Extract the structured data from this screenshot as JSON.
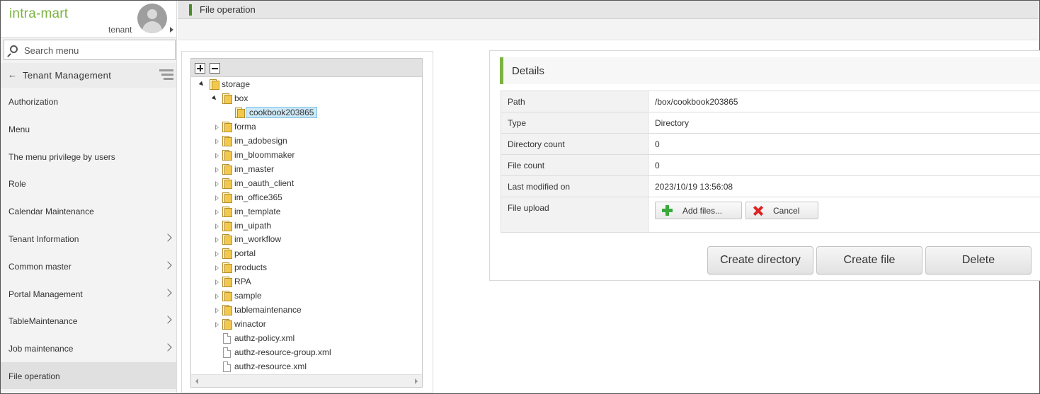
{
  "app": {
    "logo": "intra-mart",
    "tenant": "tenant"
  },
  "search": {
    "placeholder": "Search menu"
  },
  "sidebar": {
    "section_title": "Tenant Management",
    "items": [
      {
        "label": "Authorization",
        "has_submenu": false
      },
      {
        "label": "Menu",
        "has_submenu": false
      },
      {
        "label": "The menu privilege by users",
        "has_submenu": false
      },
      {
        "label": "Role",
        "has_submenu": false
      },
      {
        "label": "Calendar Maintenance",
        "has_submenu": false
      },
      {
        "label": "Tenant Information",
        "has_submenu": true
      },
      {
        "label": "Common master",
        "has_submenu": true
      },
      {
        "label": "Portal Management",
        "has_submenu": true
      },
      {
        "label": "TableMaintenance",
        "has_submenu": true
      },
      {
        "label": "Job maintenance",
        "has_submenu": true
      },
      {
        "label": "File operation",
        "has_submenu": false,
        "active": true
      }
    ]
  },
  "page": {
    "title": "File operation"
  },
  "tree": {
    "nodes": [
      {
        "label": "storage",
        "type": "folder",
        "level": 0,
        "state": "open"
      },
      {
        "label": "box",
        "type": "folder",
        "level": 1,
        "state": "open"
      },
      {
        "label": "cookbook203865",
        "type": "folder",
        "level": 2,
        "state": "leaf",
        "selected": true
      },
      {
        "label": "forma",
        "type": "folder",
        "level": 1,
        "state": "closed"
      },
      {
        "label": "im_adobesign",
        "type": "folder",
        "level": 1,
        "state": "closed"
      },
      {
        "label": "im_bloommaker",
        "type": "folder",
        "level": 1,
        "state": "closed"
      },
      {
        "label": "im_master",
        "type": "folder",
        "level": 1,
        "state": "closed"
      },
      {
        "label": "im_oauth_client",
        "type": "folder",
        "level": 1,
        "state": "closed"
      },
      {
        "label": "im_office365",
        "type": "folder",
        "level": 1,
        "state": "closed"
      },
      {
        "label": "im_template",
        "type": "folder",
        "level": 1,
        "state": "closed"
      },
      {
        "label": "im_uipath",
        "type": "folder",
        "level": 1,
        "state": "closed"
      },
      {
        "label": "im_workflow",
        "type": "folder",
        "level": 1,
        "state": "closed"
      },
      {
        "label": "portal",
        "type": "folder",
        "level": 1,
        "state": "closed"
      },
      {
        "label": "products",
        "type": "folder",
        "level": 1,
        "state": "closed"
      },
      {
        "label": "RPA",
        "type": "folder",
        "level": 1,
        "state": "closed"
      },
      {
        "label": "sample",
        "type": "folder",
        "level": 1,
        "state": "closed"
      },
      {
        "label": "tablemaintenance",
        "type": "folder",
        "level": 1,
        "state": "closed"
      },
      {
        "label": "winactor",
        "type": "folder",
        "level": 1,
        "state": "closed"
      },
      {
        "label": "authz-policy.xml",
        "type": "file",
        "level": 1,
        "state": "leaf"
      },
      {
        "label": "authz-resource-group.xml",
        "type": "file",
        "level": 1,
        "state": "leaf"
      },
      {
        "label": "authz-resource.xml",
        "type": "file",
        "level": 1,
        "state": "leaf"
      }
    ]
  },
  "details": {
    "title": "Details",
    "rows": [
      {
        "key": "Path",
        "value": "/box/cookbook203865"
      },
      {
        "key": "Type",
        "value": "Directory"
      },
      {
        "key": "Directory count",
        "value": "0"
      },
      {
        "key": "File count",
        "value": "0"
      },
      {
        "key": "Last modified on",
        "value": "2023/10/19 13:56:08"
      }
    ],
    "upload_label": "File upload",
    "add_files_label": "Add files...",
    "cancel_label": "Cancel"
  },
  "actions": {
    "create_directory": "Create directory",
    "create_file": "Create file",
    "delete": "Delete"
  },
  "colors": {
    "brand": "#7cb342",
    "title_mark": "#4a8a2a",
    "selection": "#cde8f6"
  }
}
